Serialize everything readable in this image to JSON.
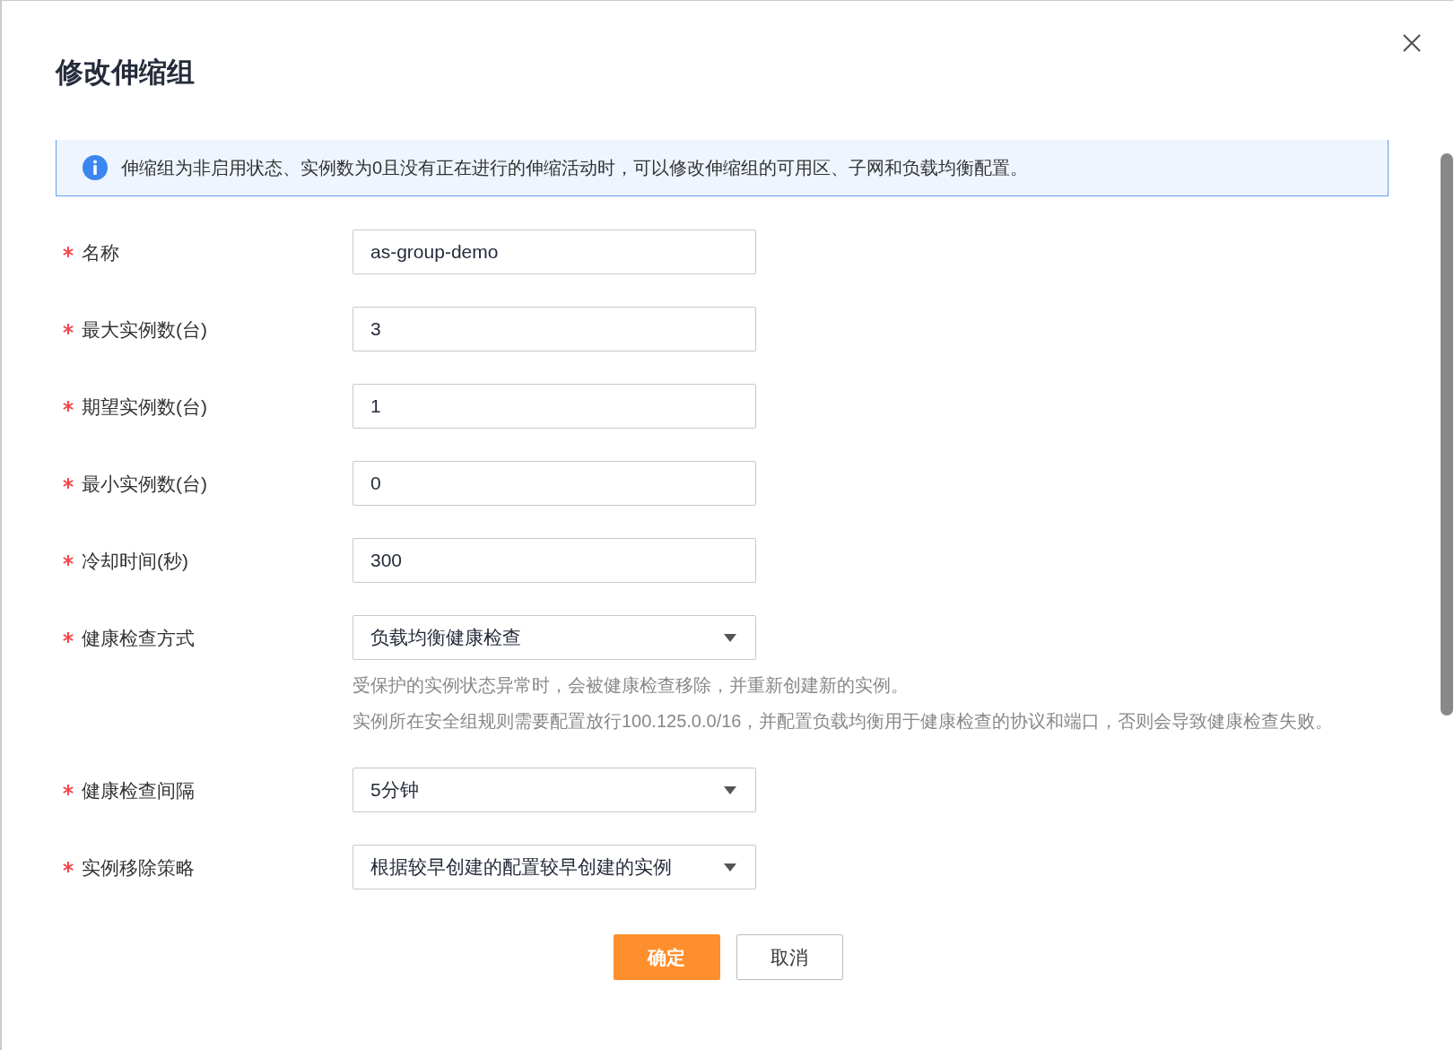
{
  "dialog": {
    "title": "修改伸缩组",
    "notice": "伸缩组为非启用状态、实例数为0且没有正在进行的伸缩活动时，可以修改伸缩组的可用区、子网和负载均衡配置。",
    "fields": [
      {
        "label": "名称",
        "required": true,
        "kind": "input",
        "value": "as-group-demo"
      },
      {
        "label": "最大实例数(台)",
        "required": true,
        "kind": "input",
        "value": "3"
      },
      {
        "label": "期望实例数(台)",
        "required": true,
        "kind": "input",
        "value": "1"
      },
      {
        "label": "最小实例数(台)",
        "required": true,
        "kind": "input",
        "value": "0"
      },
      {
        "label": "冷却时间(秒)",
        "required": true,
        "kind": "input",
        "value": "300"
      },
      {
        "label": "健康检查方式",
        "required": true,
        "kind": "select",
        "value": "负载均衡健康检查",
        "help": [
          "受保护的实例状态异常时，会被健康检查移除，并重新创建新的实例。",
          "实例所在安全组规则需要配置放行100.125.0.0/16，并配置负载均衡用于健康检查的协议和端口，否则会导致健康检查失败。"
        ]
      },
      {
        "label": "健康检查间隔",
        "required": true,
        "kind": "select",
        "value": "5分钟"
      },
      {
        "label": "实例移除策略",
        "required": true,
        "kind": "select",
        "value": "根据较早创建的配置较早创建的实例"
      }
    ],
    "buttons": [
      {
        "label": "确定",
        "kind": "primary"
      },
      {
        "label": "取消",
        "kind": "default"
      }
    ]
  }
}
